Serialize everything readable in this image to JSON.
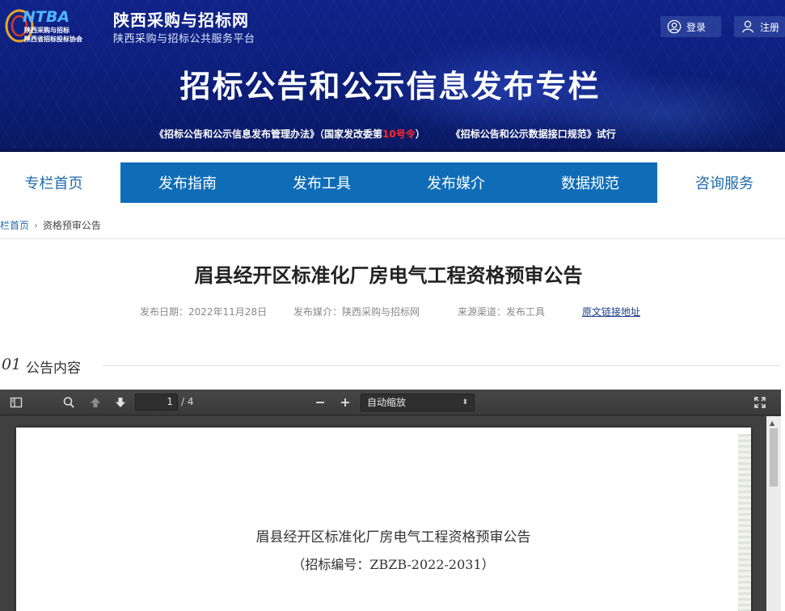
{
  "header": {
    "logo_text": "NTBA",
    "logo_sub1": "陕西采购与招标",
    "logo_sub2": "陕西省招标投标协会",
    "site_name": "陕西采购与招标网",
    "site_subtitle": "陕西采购与招标公共服务平台",
    "login_label": "登录",
    "register_label": "注册",
    "banner_title": "招标公告和公示信息发布专栏",
    "notice_part1": "《招标公告和公示信息发布管理办法》（国家发改委第",
    "notice_highlight": "10号令",
    "notice_part2": "）",
    "notice_part3": "《招标公告和公示数据接口规范》试行",
    "highlight_color": "#ff2a2a"
  },
  "nav": {
    "items": [
      "专栏首页",
      "发布指南",
      "发布工具",
      "发布媒介",
      "数据规范",
      "咨询服务"
    ],
    "accent_color": "#0f6db8"
  },
  "breadcrumb": {
    "home": "栏首页",
    "current": "资格预审公告"
  },
  "article": {
    "title": "眉县经开区标准化厂房电气工程资格预审公告",
    "publish_date": "发布日期：2022年11月28日",
    "publish_media": "发布媒介：陕西采购与招标网",
    "source_channel": "来源渠道：发布工具",
    "original_link": "原文链接地址",
    "section_number": "01",
    "section_title": "公告内容"
  },
  "pdf_viewer": {
    "current_page": "1",
    "page_total": "/ 4",
    "zoom": "自动缩放",
    "doc_title": "眉县经开区标准化厂房电气工程资格预审公告",
    "doc_number": "（招标编号：ZBZB-2022-2031）",
    "icons": [
      "sidebar-toggle-icon",
      "search-icon",
      "previous-page-icon",
      "next-page-icon",
      "zoom-out-icon",
      "zoom-in-icon",
      "fullscreen-icon"
    ]
  }
}
